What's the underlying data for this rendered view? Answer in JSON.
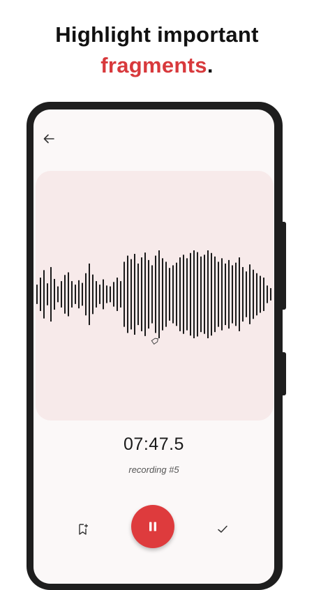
{
  "promo": {
    "line1": "Highlight important",
    "accent_word": "fragments",
    "punct": "."
  },
  "recorder": {
    "timer": "07:47.5",
    "recording_name": "recording #5"
  },
  "icons": {
    "back": "arrow-left-icon",
    "marker": "tag-icon",
    "bookmark": "bookmark-add-icon",
    "pause": "pause-icon",
    "check": "check-icon"
  },
  "colors": {
    "accent": "#d8393c",
    "waveform_card": "#f7eaea",
    "waveform_bars": "#1a1a1a",
    "pause_button": "#de3b3d"
  },
  "waveform": {
    "levels": [
      0.22,
      0.38,
      0.55,
      0.25,
      0.62,
      0.35,
      0.18,
      0.3,
      0.44,
      0.5,
      0.3,
      0.22,
      0.32,
      0.26,
      0.48,
      0.7,
      0.45,
      0.3,
      0.22,
      0.34,
      0.2,
      0.18,
      0.28,
      0.38,
      0.3,
      0.74,
      0.88,
      0.8,
      0.92,
      0.7,
      0.84,
      0.95,
      0.78,
      0.66,
      0.88,
      1.0,
      0.82,
      0.74,
      0.6,
      0.66,
      0.72,
      0.84,
      0.9,
      0.82,
      0.94,
      1.0,
      0.96,
      0.86,
      0.9,
      1.0,
      0.94,
      0.86,
      0.74,
      0.82,
      0.7,
      0.78,
      0.66,
      0.72,
      0.84,
      0.62,
      0.52,
      0.68,
      0.56,
      0.48,
      0.42,
      0.38,
      0.2,
      0.14
    ]
  }
}
